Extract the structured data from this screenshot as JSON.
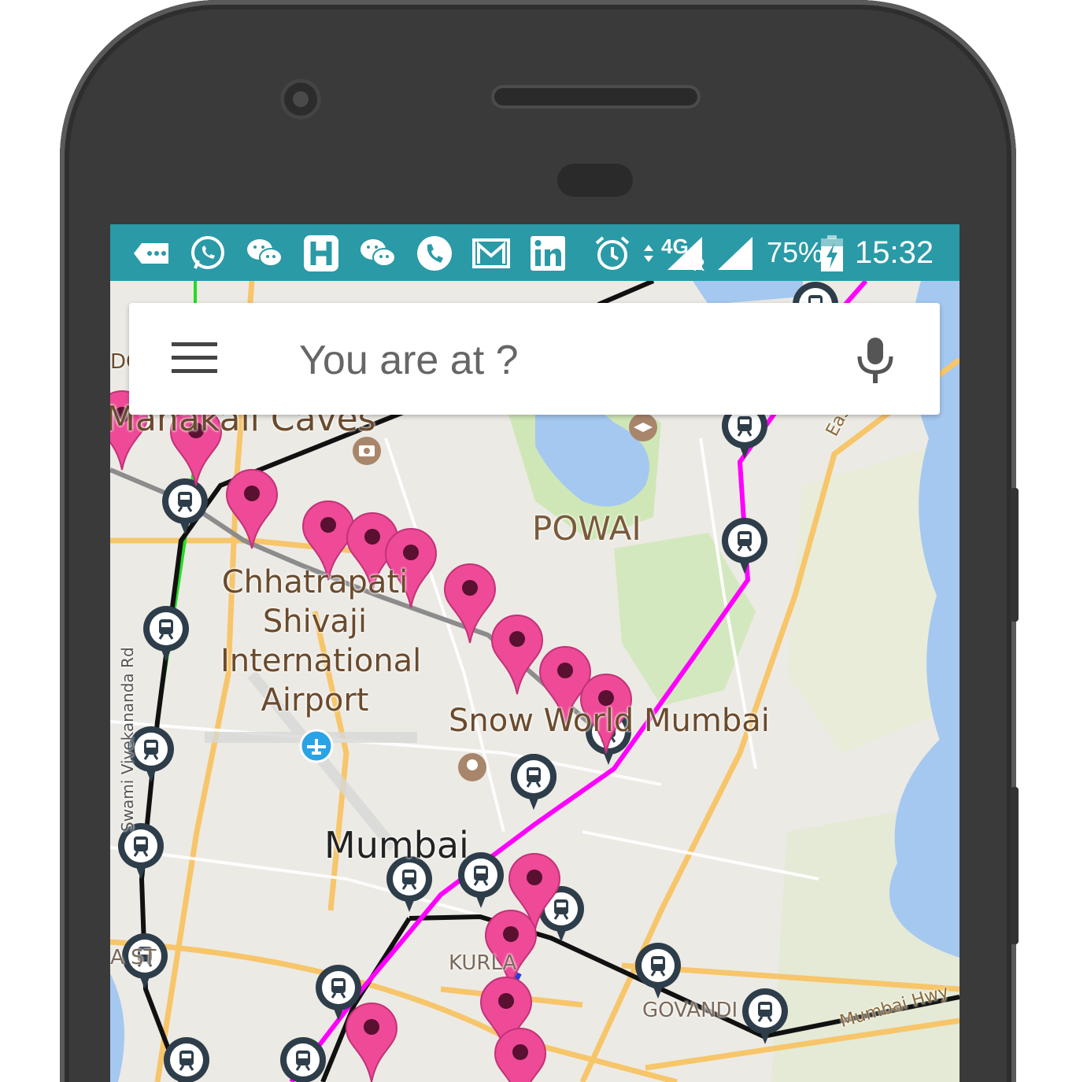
{
  "status_bar": {
    "battery": "75%",
    "time": "15:32",
    "network": "4G",
    "roaming": "R",
    "icons": [
      "message-icon",
      "whatsapp-icon",
      "wechat-icon",
      "hike-icon",
      "wechat-icon",
      "phone-icon",
      "gmail-icon",
      "linkedin-icon",
      "alarm-icon",
      "signal-icon",
      "battery-charging-icon"
    ]
  },
  "search": {
    "placeholder": "You are at ?"
  },
  "map": {
    "labels": {
      "mahakali_caves": "Mahakali Caves",
      "airport": [
        "Chhatrapati",
        "Shivaji",
        "International",
        "Airport"
      ],
      "powai": "POWAI",
      "snow_world": "Snow World Mumbai",
      "mumbai": "Mumbai",
      "kurla": "KURLA",
      "govandi": "GOVANDI",
      "eastern": "Eastern",
      "mumbai_hwy": "Mumbai Hwy",
      "vivekananda_rd": "Swami Vivekananda Rd",
      "left_edge_top": "DG",
      "left_edge_mid": "A    ST"
    },
    "colors": {
      "route_pink": "#ff00ff",
      "route_black": "#111111",
      "route_green": "#22dd22",
      "route_gray": "#8c8c8c",
      "pin_pink": "#ee4a97",
      "station_dark": "#2e3d4a",
      "water": "#a5c8f0",
      "road": "#f7c56a"
    }
  }
}
